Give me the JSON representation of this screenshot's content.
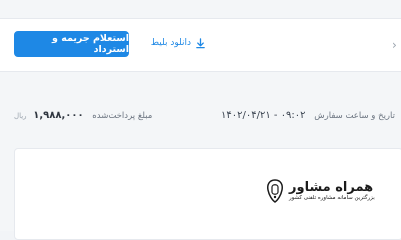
{
  "header": {
    "inquiry_button_label": "استعلام جریمه و استرداد",
    "download_ticket_label": "دانلود بلیط",
    "download_icon": "download-icon",
    "partial_icon": "arrow-icon"
  },
  "order": {
    "datetime_label": "تاریخ و ساعت سفارش",
    "datetime_value": "۱۴۰۲/۰۴/۲۱ - ۰۹:۰۲",
    "amount_label": "مبلغ پرداخت‌شده",
    "amount_value": "۱,۹۸۸,۰۰۰",
    "currency": "ریال"
  },
  "watermark": {
    "title": "همراه مشاور",
    "subtitle": "بزرگترین سامانه مشاوره تلفنی کشور"
  },
  "colors": {
    "accent": "#1e88e5",
    "background": "#f4f6f8",
    "panel": "#ffffff"
  }
}
